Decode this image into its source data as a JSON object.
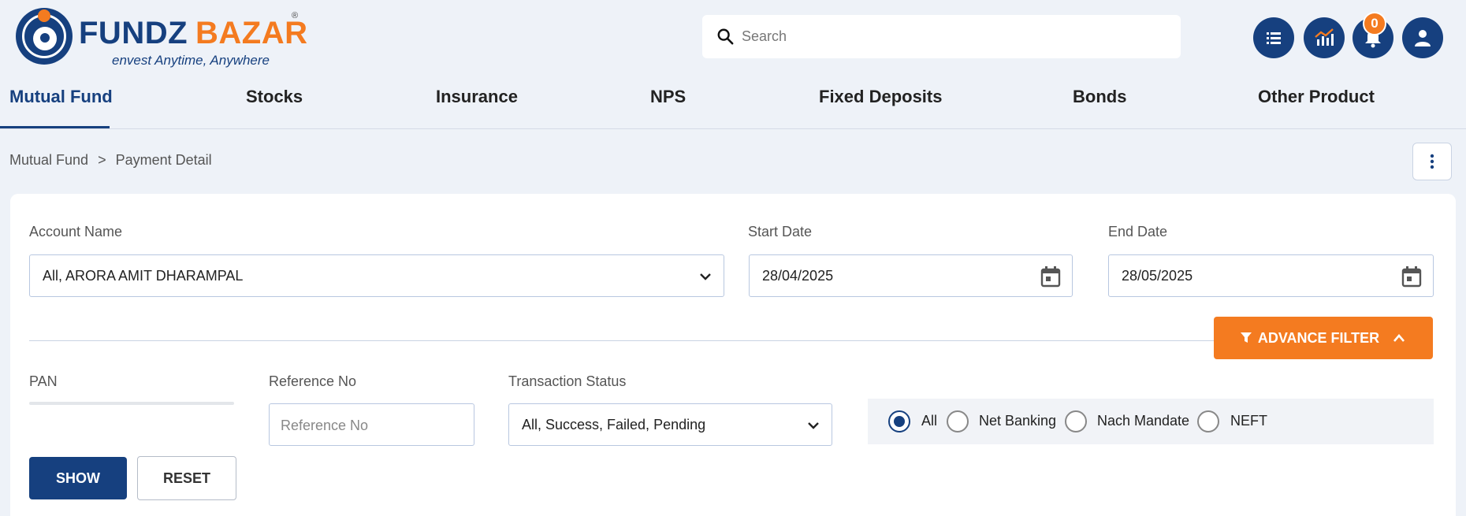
{
  "brand": {
    "name_part1": "FUNDZ",
    "name_part2": "BAZAR",
    "registered": "®",
    "tagline": "envest Anytime, Anywhere"
  },
  "search": {
    "placeholder": "Search"
  },
  "header_icons": [
    "list-icon",
    "chart-icon",
    "bell-icon",
    "user-icon"
  ],
  "notifications": {
    "count": "0"
  },
  "nav": {
    "items": [
      "Mutual Fund",
      "Stocks",
      "Insurance",
      "NPS",
      "Fixed Deposits",
      "Bonds",
      "Other Product"
    ],
    "active_index": 0
  },
  "breadcrumb": {
    "items": [
      "Mutual Fund",
      "Payment Detail"
    ]
  },
  "form": {
    "account_name_label": "Account Name",
    "account_name_value": "All, ARORA AMIT DHARAMPAL",
    "start_date_label": "Start Date",
    "start_date_value": "28/04/2025",
    "end_date_label": "End Date",
    "end_date_value": "28/05/2025",
    "advance_filter_label": "ADVANCE FILTER",
    "pan_label": "PAN",
    "reference_label": "Reference No",
    "reference_placeholder": "Reference No",
    "status_label": "Transaction Status",
    "status_value": "All, Success, Failed, Pending",
    "payment_modes": [
      "All",
      "Net Banking",
      "Nach Mandate",
      "NEFT"
    ],
    "payment_mode_selected": "All",
    "show_label": "SHOW",
    "reset_label": "RESET"
  },
  "colors": {
    "primary": "#16407f",
    "accent": "#f47b20",
    "background": "#eef2f8"
  }
}
